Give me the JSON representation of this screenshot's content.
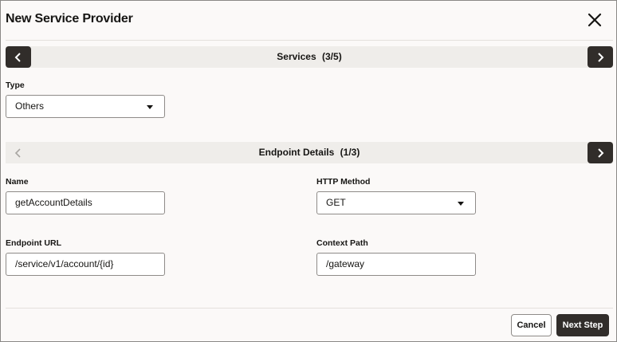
{
  "dialog": {
    "title": "New Service Provider",
    "close_icon": "close-icon"
  },
  "services_nav": {
    "label": "Services",
    "count": "(3/5)",
    "prev_icon": "chevron-left-icon",
    "next_icon": "chevron-right-icon"
  },
  "type_field": {
    "label": "Type",
    "value": "Others"
  },
  "endpoint_nav": {
    "label": "Endpoint Details",
    "count": "(1/3)",
    "prev_disabled": true
  },
  "name_field": {
    "label": "Name",
    "value": "getAccountDetails"
  },
  "http_method_field": {
    "label": "HTTP Method",
    "value": "GET"
  },
  "endpoint_url_field": {
    "label": "Endpoint URL",
    "value": "/service/v1/account/{id}"
  },
  "context_path_field": {
    "label": "Context Path",
    "value": "/gateway"
  },
  "footer": {
    "cancel_label": "Cancel",
    "next_label": "Next Step"
  },
  "colors": {
    "dark_button": "#312d2a",
    "bar_background": "#efedea",
    "dialog_background": "#fbf9f8"
  }
}
